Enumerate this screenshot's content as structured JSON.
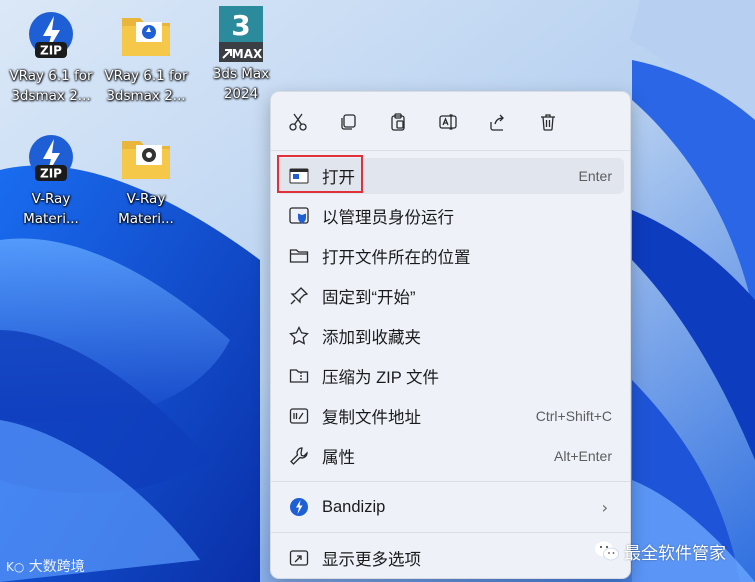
{
  "desktop": {
    "icons": [
      {
        "label_line1": "VRay 6.1 for",
        "label_line2": "3dsmax 2...",
        "badge": "ZIP",
        "icon": "bandizip-archive-icon"
      },
      {
        "label_line1": "VRay 6.1 for",
        "label_line2": "3dsmax 2...",
        "icon": "folder-icon"
      },
      {
        "label_line1": "3ds Max",
        "label_line2": "2024",
        "badge_top": "3",
        "badge_bottom": "MAX",
        "icon": "3ds-max-icon"
      },
      {
        "label_line1": "V-Ray",
        "label_line2": "Materi...",
        "badge": "ZIP",
        "icon": "bandizip-archive-icon"
      },
      {
        "label_line1": "V-Ray",
        "label_line2": "Materi...",
        "icon": "folder-icon"
      }
    ]
  },
  "context_menu": {
    "toolbar": [
      {
        "name": "cut",
        "icon": "scissors-icon"
      },
      {
        "name": "copy",
        "icon": "copy-icon"
      },
      {
        "name": "paste",
        "icon": "clipboard-icon"
      },
      {
        "name": "rename",
        "icon": "rename-icon"
      },
      {
        "name": "share",
        "icon": "share-icon"
      },
      {
        "name": "delete",
        "icon": "trash-icon"
      }
    ],
    "items": [
      {
        "label": "打开",
        "shortcut": "Enter",
        "icon": "app-window-icon"
      },
      {
        "label": "以管理员身份运行",
        "shortcut": "",
        "icon": "shield-icon"
      },
      {
        "label": "打开文件所在的位置",
        "shortcut": "",
        "icon": "folder-outline-icon"
      },
      {
        "label": "固定到“开始”",
        "shortcut": "",
        "icon": "pin-icon"
      },
      {
        "label": "添加到收藏夹",
        "shortcut": "",
        "icon": "star-icon"
      },
      {
        "label": "压缩为 ZIP 文件",
        "shortcut": "",
        "icon": "zip-folder-icon"
      },
      {
        "label": "复制文件地址",
        "shortcut": "Ctrl+Shift+C",
        "icon": "path-icon"
      },
      {
        "label": "属性",
        "shortcut": "Alt+Enter",
        "icon": "wrench-icon"
      },
      {
        "label": "Bandizip",
        "shortcut": "",
        "icon": "bandizip-icon"
      },
      {
        "label": "显示更多选项",
        "shortcut": "",
        "icon": "more-options-icon"
      }
    ]
  },
  "watermarks": {
    "left": "大数跨境",
    "right": "最全软件管家"
  },
  "colors": {
    "highlight_box": "#e0303a",
    "bandizip_blue": "#1f5fd6",
    "folder_yellow": "#f5c84a",
    "max_teal": "#2b8a9c"
  }
}
